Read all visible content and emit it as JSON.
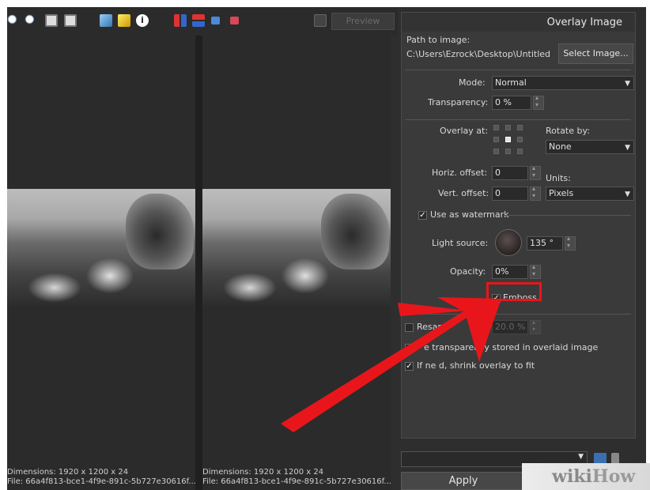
{
  "toolbar": {
    "icons": [
      "zoom-in-icon",
      "zoom-out-icon",
      "fit-icon",
      "actual-size-icon",
      "image-icon",
      "star-icon",
      "info-icon",
      "split-vertical-icon",
      "split-horizontal-icon",
      "blue-square-icon",
      "red-square-icon",
      "lock-icon"
    ],
    "preview_label": "Preview"
  },
  "left_pane": {
    "dimensions": "Dimensions: 1920 x 1200 x 24",
    "file": "File: 66a4f813-bce1-4f9e-891c-5b727e30616f..."
  },
  "right_pane": {
    "dimensions": "Dimensions: 1920 x 1200 x 24",
    "file": "File: 66a4f813-bce1-4f9e-891c-5b727e30616f..."
  },
  "panel": {
    "title": "Overlay Image",
    "path_label": "Path to image:",
    "path_value": "C:\\Users\\Ezrock\\Desktop\\Untitled",
    "select_image_label": "Select Image...",
    "mode_label": "Mode:",
    "mode_value": "Normal",
    "transparency_label": "Transparency:",
    "transparency_value": "0 %",
    "overlay_at_label": "Overlay at:",
    "rotate_by_label": "Rotate by:",
    "rotate_value": "None",
    "horiz_offset_label": "Horiz. offset:",
    "horiz_offset_value": "0",
    "vert_offset_label": "Vert. offset:",
    "vert_offset_value": "0",
    "units_label": "Units:",
    "units_value": "Pixels",
    "use_watermark_label": "Use as watermark",
    "light_source_label": "Light source:",
    "light_source_value": "135 °",
    "opacity_label": "Opacity:",
    "opacity_value": "0%",
    "emboss_label": "Emboss",
    "resample_label": "Resam",
    "resample_value": "20.0 %",
    "use_transparency_label": "e transparency stored in overlaid image",
    "shrink_label": "If ne   d, shrink overlay to fit"
  },
  "bottom": {
    "apply_label": "Apply"
  },
  "watermark": {
    "wiki": "wiki",
    "how": "How"
  },
  "colors": {
    "highlight": "#e8161b",
    "panel_bg": "#3a3a3a",
    "frame_bg": "#2e2e2e"
  }
}
